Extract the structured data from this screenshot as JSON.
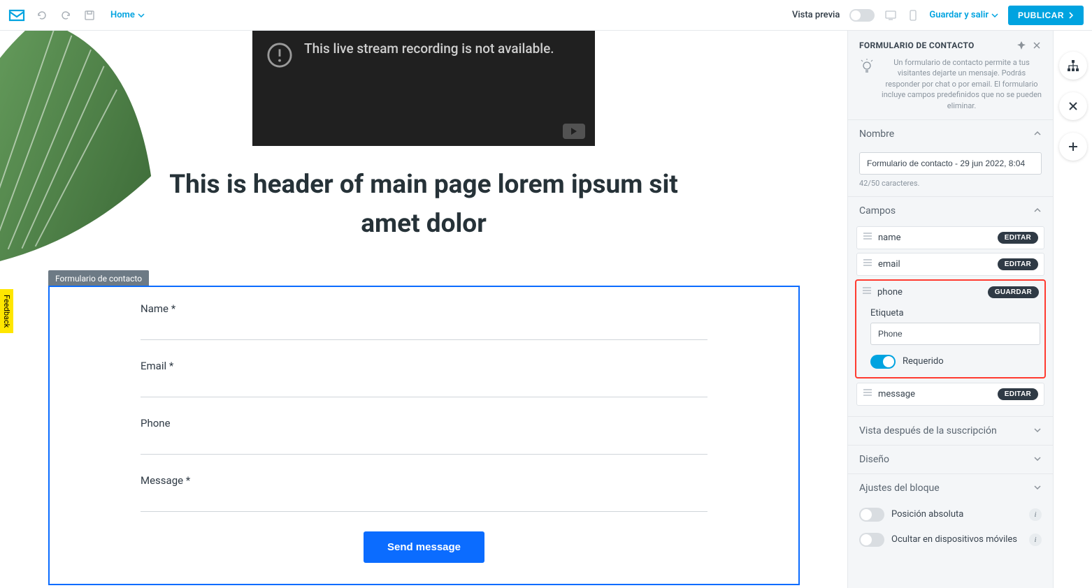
{
  "topbar": {
    "home_label": "Home",
    "vista_previa": "Vista previa",
    "guardar_salir": "Guardar y salir",
    "publicar": "PUBLICAR"
  },
  "feedback_label": "Feedback",
  "canvas": {
    "video_unavailable": "This live stream recording is not available.",
    "heading": "This is header of main page lorem ipsum sit amet dolor",
    "form_tag": "Formulario de contacto",
    "labels": {
      "name": "Name *",
      "email": "Email *",
      "phone": "Phone",
      "message": "Message *"
    },
    "send_button": "Send message"
  },
  "panel": {
    "title": "FORMULARIO DE CONTACTO",
    "tip": "Un formulario de contacto permite a tus visitantes dejarte un mensaje. Podrás responder por chat o por email. El formulario incluye campos predefinidos que no se pueden eliminar.",
    "sections": {
      "nombre": "Nombre",
      "campos": "Campos",
      "vista_susc": "Vista después de la suscripción",
      "diseno": "Diseño",
      "ajustes": "Ajustes del bloque"
    },
    "name_input_value": "Formulario de contacto - 29 jun 2022, 8:04",
    "char_count": "42/50 caracteres.",
    "fields": [
      {
        "key": "name",
        "label": "name",
        "action": "EDITAR"
      },
      {
        "key": "email",
        "label": "email",
        "action": "EDITAR"
      },
      {
        "key": "phone",
        "label": "phone",
        "action": "GUARDAR"
      },
      {
        "key": "message",
        "label": "message",
        "action": "EDITAR"
      }
    ],
    "phone_edit": {
      "etiqueta_label": "Etiqueta",
      "etiqueta_value": "Phone",
      "requerido_label": "Requerido"
    },
    "options": {
      "pos_absoluta": "Posición absoluta",
      "ocultar_movil": "Ocultar en dispositivos móviles"
    }
  }
}
